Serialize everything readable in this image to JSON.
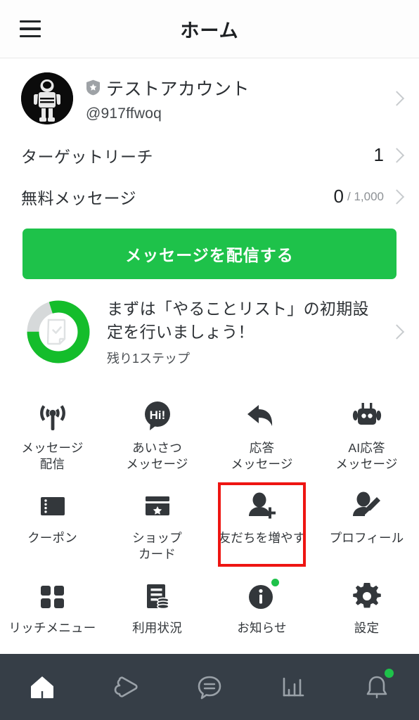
{
  "header": {
    "menu_icon": "hamburger-menu-icon",
    "title": "ホーム"
  },
  "account": {
    "avatar_icon": "astronaut-avatar",
    "verified_icon": "verified-shield-icon",
    "name": "テストアカウント",
    "handle": "@917ffwoq",
    "chevron_icon": "chevron-right-icon"
  },
  "stats": [
    {
      "label": "ターゲットリーチ",
      "value": "1",
      "value_sub": "",
      "chevron_icon": "chevron-right-icon"
    },
    {
      "label": "無料メッセージ",
      "value": "0",
      "value_sub": "/ 1,000",
      "chevron_icon": "chevron-right-icon"
    }
  ],
  "cta": {
    "label": "メッセージを配信する",
    "color": "#1ec24a"
  },
  "todo": {
    "progress_percent": 80,
    "ring_color": "#14bd2b",
    "ring_track_color": "#d6d9da",
    "ring_icon": "checklist-document-icon",
    "title": "まずは「やることリスト」の初期設定を行いましょう！",
    "subtitle": "残り1ステップ",
    "chevron_icon": "chevron-right-icon"
  },
  "grid": {
    "highlight_color": "#ee1512",
    "rows": [
      [
        {
          "icon": "broadcast-icon",
          "label": "メッセージ\n配信",
          "badge": false,
          "highlighted": false
        },
        {
          "icon": "greeting-hi-bubble-icon",
          "label": "あいさつ\nメッセージ",
          "badge": false,
          "highlighted": false
        },
        {
          "icon": "reply-arrow-icon",
          "label": "応答\nメッセージ",
          "badge": false,
          "highlighted": false
        },
        {
          "icon": "robot-icon",
          "label": "AI応答\nメッセージ",
          "badge": false,
          "highlighted": false
        }
      ],
      [
        {
          "icon": "coupon-ticket-icon",
          "label": "クーポン",
          "badge": false,
          "highlighted": false
        },
        {
          "icon": "shop-card-icon",
          "label": "ショップ\nカード",
          "badge": false,
          "highlighted": false
        },
        {
          "icon": "add-friend-icon",
          "label": "友だちを増やす",
          "badge": false,
          "highlighted": true
        },
        {
          "icon": "profile-edit-icon",
          "label": "プロフィール",
          "badge": false,
          "highlighted": false
        }
      ],
      [
        {
          "icon": "rich-menu-grid-icon",
          "label": "リッチメニュー",
          "badge": false,
          "highlighted": false
        },
        {
          "icon": "usage-document-coins-icon",
          "label": "利用状況",
          "badge": false,
          "highlighted": false
        },
        {
          "icon": "info-circle-icon",
          "label": "お知らせ",
          "badge": true,
          "highlighted": false
        },
        {
          "icon": "gear-icon",
          "label": "設定",
          "badge": false,
          "highlighted": false
        }
      ]
    ]
  },
  "bottom_nav": {
    "background": "#363e47",
    "items": [
      {
        "icon": "home-icon",
        "active": true,
        "badge": false
      },
      {
        "icon": "voom-play-icon",
        "active": false,
        "badge": false
      },
      {
        "icon": "chat-bubble-icon",
        "active": false,
        "badge": false
      },
      {
        "icon": "chart-bar-icon",
        "active": false,
        "badge": false
      },
      {
        "icon": "bell-icon",
        "active": false,
        "badge": true
      }
    ]
  }
}
